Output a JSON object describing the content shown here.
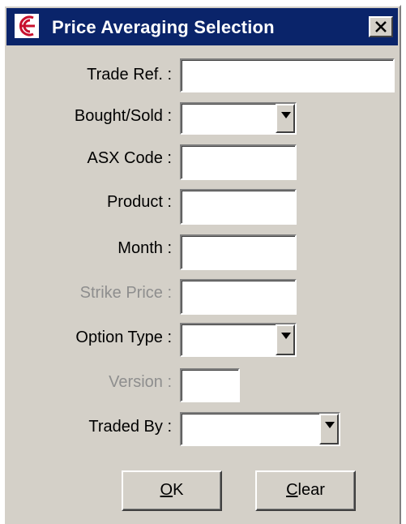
{
  "window": {
    "title": "Price Averaging Selection",
    "close_label": "Close"
  },
  "form": {
    "trade_ref": {
      "label": "Trade Ref. :",
      "value": ""
    },
    "bought_sold": {
      "label": "Bought/Sold :",
      "value": ""
    },
    "asx_code": {
      "label": "ASX Code :",
      "value": ""
    },
    "product": {
      "label": "Product :",
      "value": ""
    },
    "month": {
      "label": "Month :",
      "value": ""
    },
    "strike_price": {
      "label": "Strike Price :",
      "value": ""
    },
    "option_type": {
      "label": "Option Type :",
      "value": ""
    },
    "version": {
      "label": "Version :",
      "value": ""
    },
    "traded_by": {
      "label": "Traded By :",
      "value": ""
    }
  },
  "buttons": {
    "ok": {
      "mnemonic": "O",
      "rest": "K"
    },
    "clear": {
      "mnemonic": "C",
      "rest": "lear"
    }
  },
  "colors": {
    "titlebar": "#0a246a",
    "face": "#d4d0c8",
    "disabled_text": "#8e8e8e",
    "icon_red": "#c8102e"
  }
}
